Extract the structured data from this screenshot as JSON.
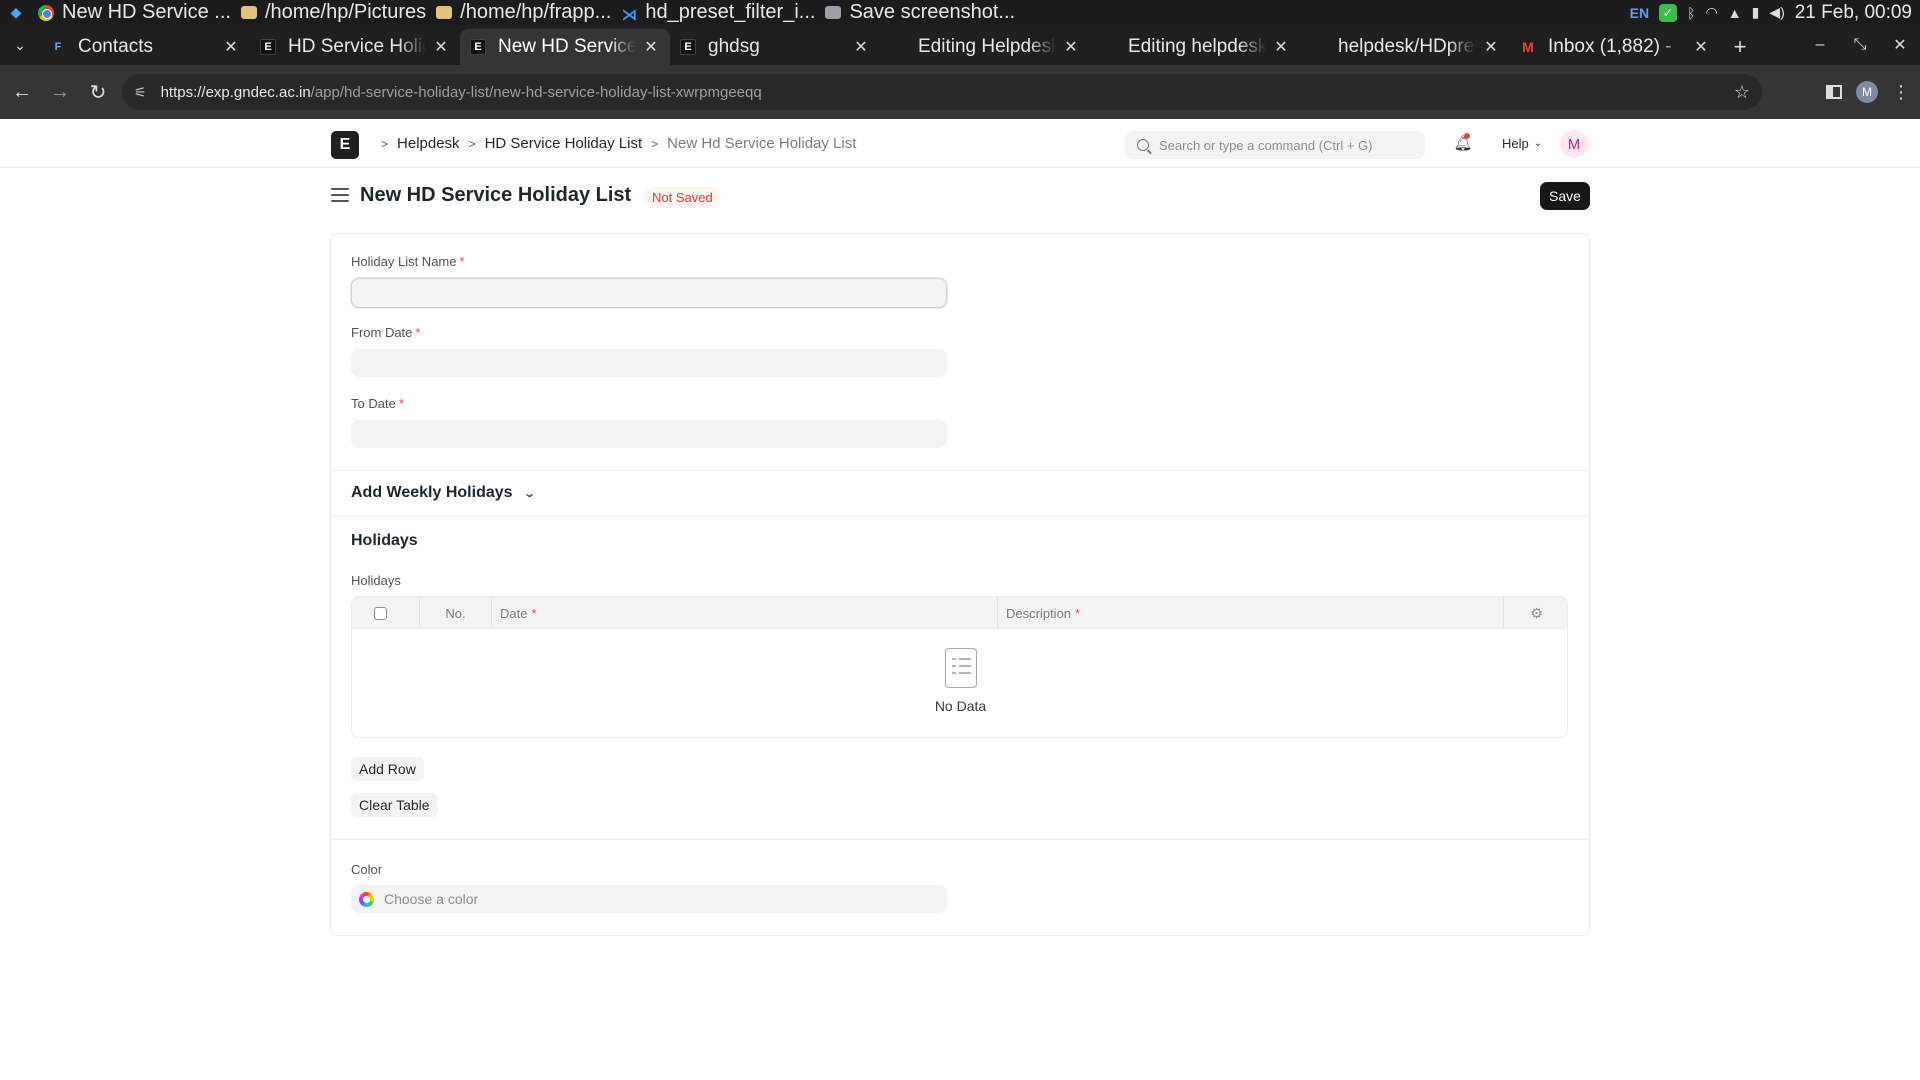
{
  "os": {
    "tasks": [
      {
        "label": "New HD Service ...",
        "icon": "chrome-icon"
      },
      {
        "label": "/home/hp/Pictures",
        "icon": "folder-icon"
      },
      {
        "label": "/home/hp/frapp...",
        "icon": "folder-icon"
      },
      {
        "label": "hd_preset_filter_i...",
        "icon": "vscode-icon"
      },
      {
        "label": "Save screenshot...",
        "icon": "screenshot-icon"
      }
    ],
    "lang": "EN",
    "datetime": "21 Feb, 00:09"
  },
  "browser": {
    "tabs": [
      {
        "label": "Contacts",
        "favicon": "F"
      },
      {
        "label": "HD Service Holiday List",
        "favicon": "E"
      },
      {
        "label": "New HD Service Holiday List",
        "favicon": "E",
        "active": true
      },
      {
        "label": "ghdsg",
        "favicon": "E"
      },
      {
        "label": "Editing Helpdesk",
        "favicon": ""
      },
      {
        "label": "Editing helpdesk",
        "favicon": ""
      },
      {
        "label": "helpdesk/HDpreset",
        "favicon": ""
      },
      {
        "label": "Inbox (1,882) -",
        "favicon": "M"
      }
    ],
    "url_host": "https://exp.gndec.ac.in",
    "url_path": "/app/hd-service-holiday-list/new-hd-service-holiday-list-xwrpmgeeqq",
    "profile_initial": "M"
  },
  "navbar": {
    "breadcrumbs": [
      "Helpdesk",
      "HD Service Holiday List",
      "New Hd Service Holiday List"
    ],
    "search_placeholder": "Search or type a command (Ctrl + G)",
    "help_label": "Help",
    "avatar_initial": "M",
    "logo_letter": "E"
  },
  "page": {
    "title": "New HD Service Holiday List",
    "status": "Not Saved",
    "save_label": "Save"
  },
  "form": {
    "holiday_list_name_label": "Holiday List Name",
    "from_date_label": "From Date",
    "to_date_label": "To Date",
    "required_mark": "*",
    "weekly_section": "Add Weekly Holidays",
    "holidays_section": "Holidays",
    "holidays_table_label": "Holidays",
    "table_columns": {
      "no": "No.",
      "date": "Date",
      "description": "Description"
    },
    "no_data": "No Data",
    "add_row": "Add Row",
    "clear_table": "Clear Table",
    "color_label": "Color",
    "color_placeholder": "Choose a color"
  }
}
